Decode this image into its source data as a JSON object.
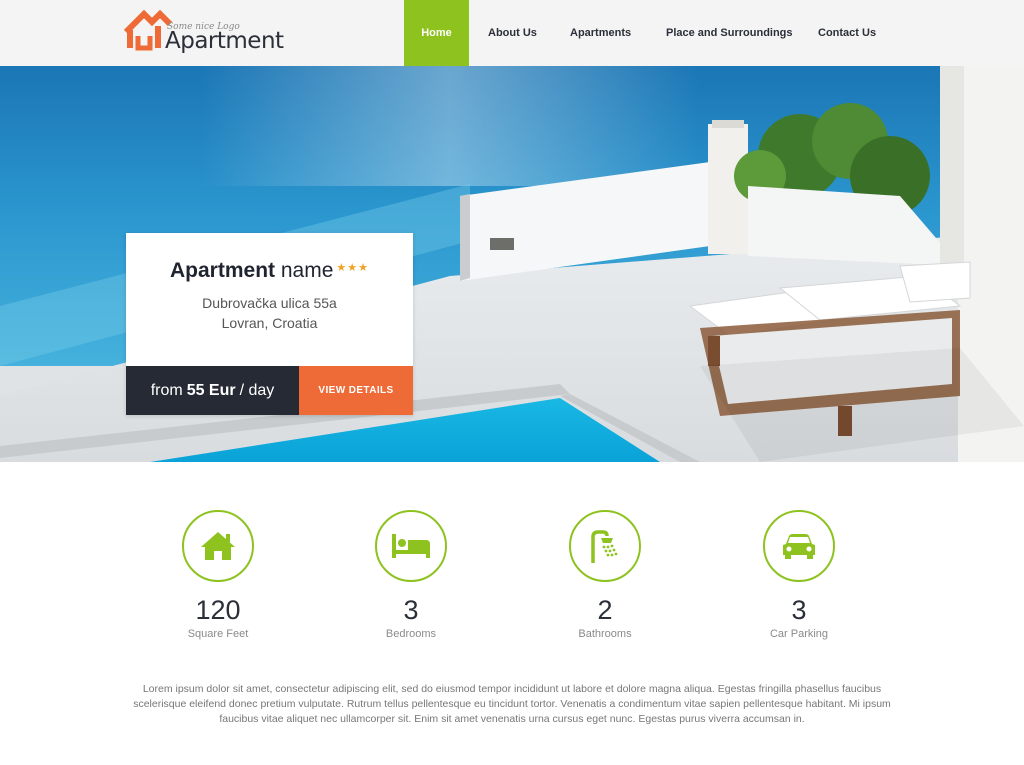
{
  "logo": {
    "tagline": "Some nice Logo",
    "name": "Apartment",
    "accent_color": "#ee6a36"
  },
  "nav": {
    "items": [
      {
        "label": "Home",
        "active": true
      },
      {
        "label": "About Us",
        "active": false
      },
      {
        "label": "Apartments",
        "active": false
      },
      {
        "label": "Place and Surroundings",
        "active": false
      },
      {
        "label": "Contact Us",
        "active": false
      }
    ],
    "active_color": "#8dc21f"
  },
  "card": {
    "title_bold": "Apartment",
    "title_light": "name",
    "stars": "★★★",
    "address_line1": "Dubrovačka ulica 55a",
    "address_line2": "Lovran, Croatia",
    "price_prefix": "from",
    "price_value": "55 Eur",
    "price_suffix": "/ day",
    "button_label": "VIEW DETAILS",
    "button_color": "#ee6a36"
  },
  "features": [
    {
      "icon": "house-icon",
      "value": "120",
      "label": "Square Feet"
    },
    {
      "icon": "bed-icon",
      "value": "3",
      "label": "Bedrooms"
    },
    {
      "icon": "shower-icon",
      "value": "2",
      "label": "Bathrooms"
    },
    {
      "icon": "car-icon",
      "value": "3",
      "label": "Car Parking"
    }
  ],
  "description": "Lorem ipsum dolor sit amet, consectetur adipiscing elit, sed do eiusmod tempor incididunt ut labore et dolore magna aliqua. Egestas fringilla phasellus faucibus scelerisque eleifend donec pretium vulputate. Rutrum tellus pellentesque eu tincidunt tortor. Venenatis a condimentum vitae sapien pellentesque habitant. Mi ipsum faucibus vitae aliquet nec ullamcorper sit. Enim sit amet venenatis urna cursus eget nunc. Egestas purus viverra accumsan in."
}
